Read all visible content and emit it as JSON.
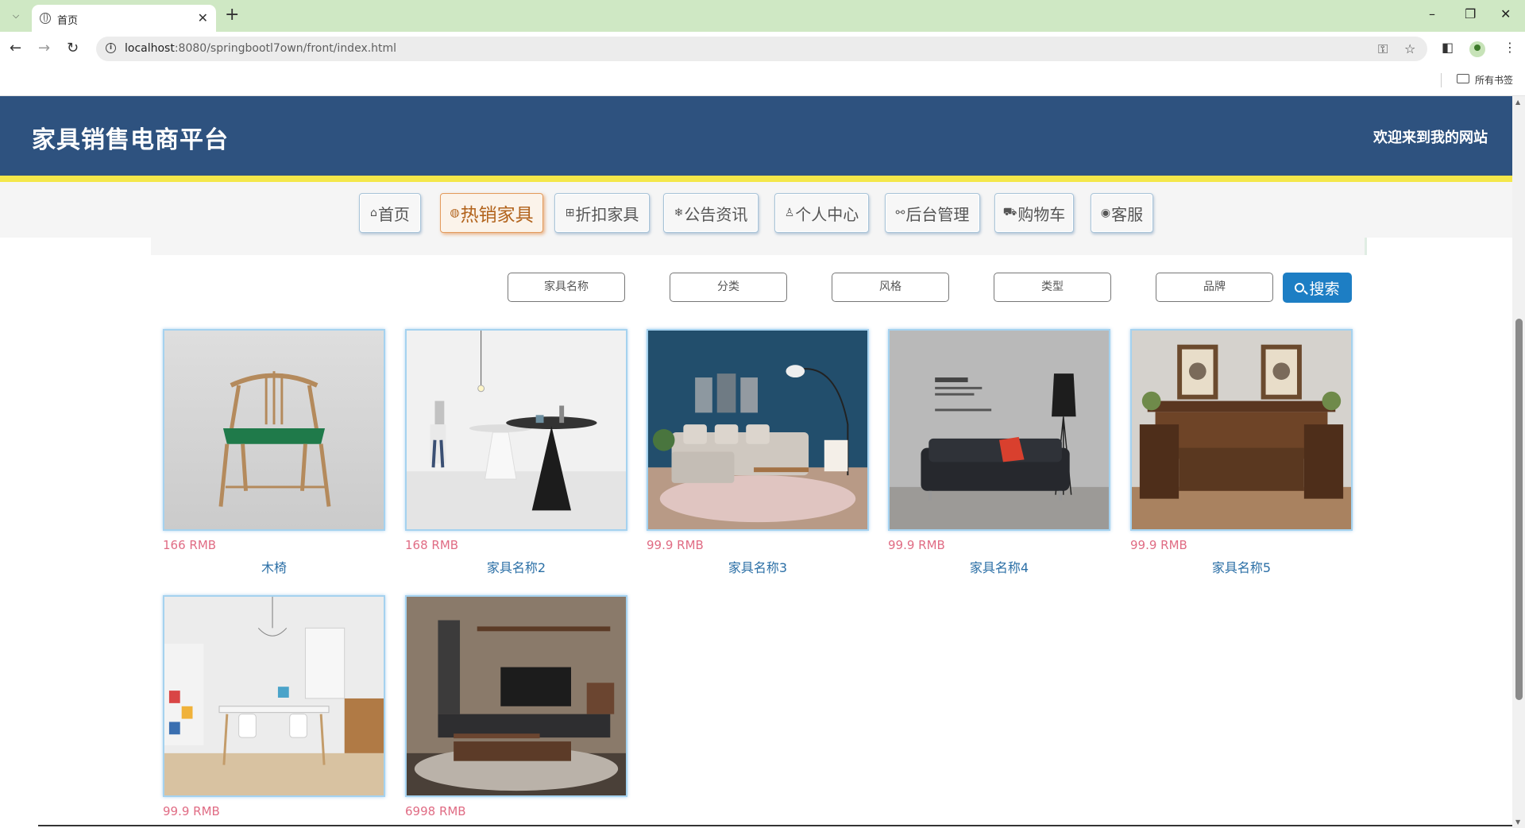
{
  "browser": {
    "tab_title": "首页",
    "url_host": "localhost",
    "url_path": ":8080/springbootl7own/front/index.html",
    "bookmarks_label": "所有书签"
  },
  "site": {
    "title": "家具销售电商平台",
    "welcome": "欢迎来到我的网站"
  },
  "nav": [
    {
      "icon": "home-icon",
      "label": "首页"
    },
    {
      "icon": "fire-icon",
      "label": "热销家具"
    },
    {
      "icon": "gift-icon",
      "label": "折扣家具"
    },
    {
      "icon": "snowflake-icon",
      "label": "公告资讯"
    },
    {
      "icon": "user-icon",
      "label": "个人中心"
    },
    {
      "icon": "link-icon",
      "label": "后台管理"
    },
    {
      "icon": "cart-icon",
      "label": "购物车"
    },
    {
      "icon": "headset-icon",
      "label": "客服"
    }
  ],
  "search": {
    "name_placeholder": "家具名称",
    "category_placeholder": "分类",
    "style_placeholder": "风格",
    "type_placeholder": "类型",
    "brand_placeholder": "品牌",
    "button_label": "搜索"
  },
  "products": [
    {
      "price": "166 RMB",
      "name": "木椅"
    },
    {
      "price": "168 RMB",
      "name": "家具名称2"
    },
    {
      "price": "99.9 RMB",
      "name": "家具名称3"
    },
    {
      "price": "99.9 RMB",
      "name": "家具名称4"
    },
    {
      "price": "99.9 RMB",
      "name": "家具名称5"
    },
    {
      "price": "99.9 RMB",
      "name": ""
    },
    {
      "price": "6998 RMB",
      "name": ""
    }
  ],
  "colors": {
    "header_bg": "#2e527f",
    "accent_bar": "#f4e74a",
    "search_button": "#1d7ec4",
    "price": "#e06c84",
    "product_name": "#2b6fa6"
  }
}
